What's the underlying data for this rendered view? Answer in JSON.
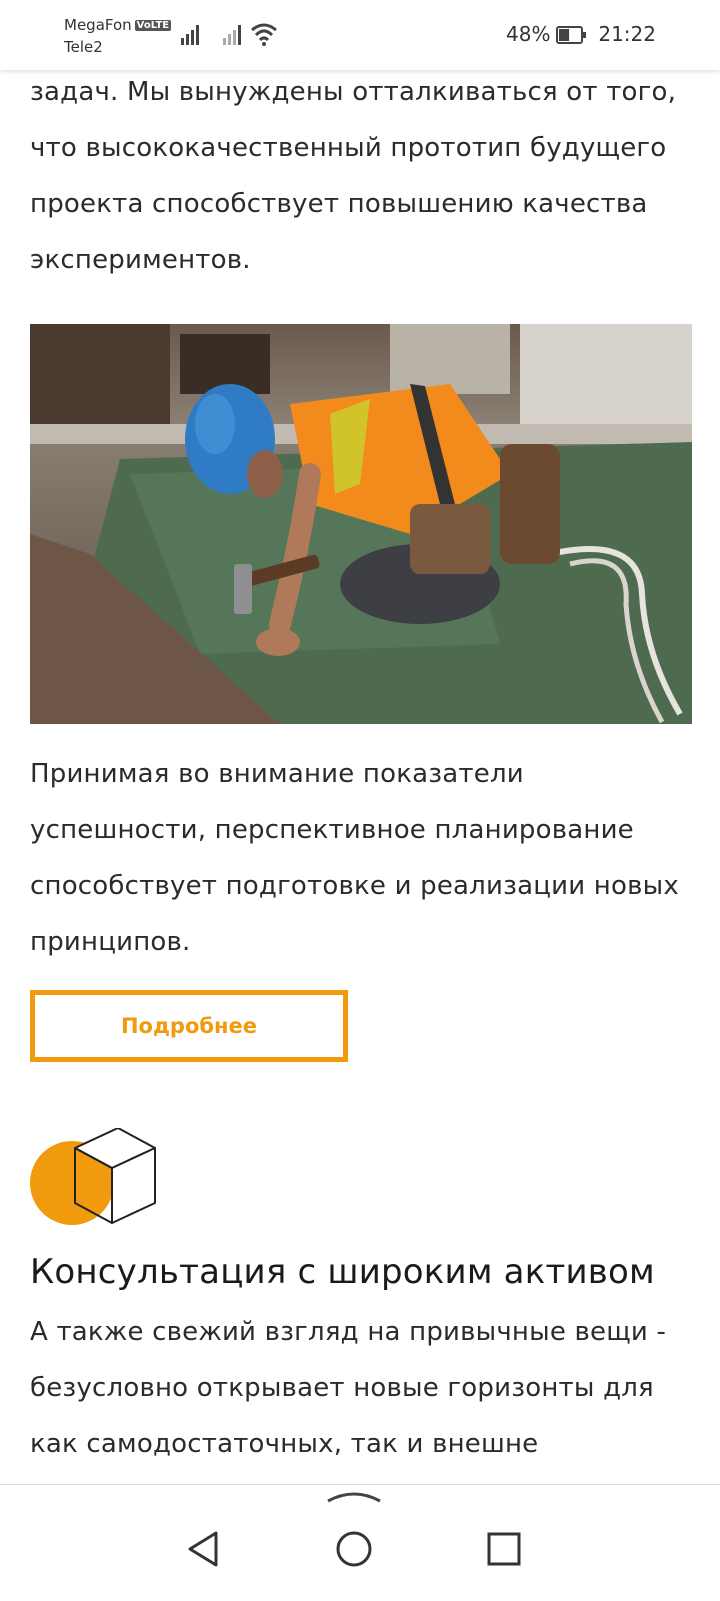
{
  "status_bar": {
    "carrier_1": "MegaFon",
    "volte": "VoLTE",
    "carrier_2": "Tele2",
    "battery_percent": "48%",
    "battery_level": 0.48,
    "time": "21:22"
  },
  "article": {
    "para_1": "задач. Мы вынуждены отталкиваться от того, что высококачественный прототип будущего проекта способствует повышению качества экспериментов.",
    "para_2": "Принимая во внимание показатели успешности, перспективное планирование способствует подготовке и реализации новых принципов.",
    "more_button": "Подробнее"
  },
  "feature": {
    "title": "Консультация с широким активом",
    "text": "А также свежий взгляд на привычные вещи - безусловно открывает новые горизонты для как самодостаточных, так и внешне"
  },
  "colors": {
    "accent": "#f29a0d"
  },
  "icons": [
    "signal-icon",
    "wifi-icon",
    "battery-icon",
    "cube-icon",
    "back-icon",
    "home-icon",
    "recents-icon",
    "swipe-up-icon"
  ]
}
